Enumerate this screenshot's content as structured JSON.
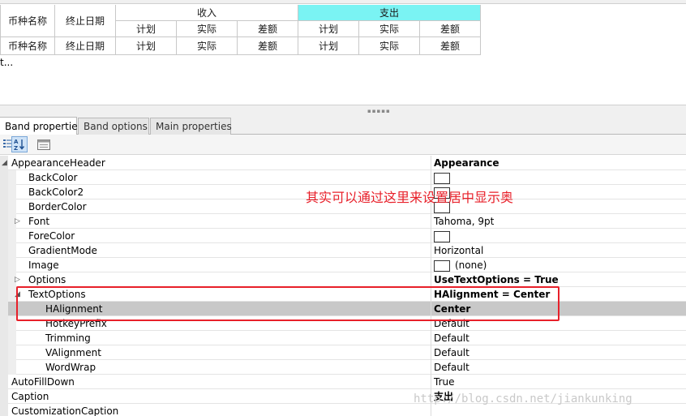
{
  "preview": {
    "header": {
      "currency_name": "币种名称",
      "end_date": "终止日期",
      "income_band": "收入",
      "expense_band": "支出",
      "income_cols": [
        "计划",
        "实际",
        "差额"
      ],
      "expense_cols": [
        "计划",
        "实际",
        "差额"
      ]
    },
    "data_row": {
      "currency_name": "币种名称",
      "end_date": "终止日期",
      "cells": [
        "计划",
        "实际",
        "差额",
        "计划",
        "实际",
        "差额"
      ]
    },
    "truncated_text": "t..."
  },
  "tabs": [
    {
      "label": "Band properties",
      "active": true
    },
    {
      "label": "Band options",
      "active": false
    },
    {
      "label": "Main properties",
      "active": false
    }
  ],
  "toolbar": {
    "categorized_icon": "categorized-icon",
    "alphabetical_icon": "sort-az-icon",
    "property_pages_icon": "property-pages-icon"
  },
  "properties": [
    {
      "name": "AppearanceHeader",
      "value": "Appearance",
      "bold": true,
      "level": 0,
      "expander": "collapse"
    },
    {
      "name": "BackColor",
      "value": "",
      "swatch": true,
      "level": 1
    },
    {
      "name": "BackColor2",
      "value": "",
      "swatch": true,
      "level": 1
    },
    {
      "name": "BorderColor",
      "value": "",
      "swatch": true,
      "level": 1
    },
    {
      "name": "Font",
      "value": "Tahoma, 9pt",
      "level": 1,
      "expander": "expand"
    },
    {
      "name": "ForeColor",
      "value": "",
      "swatch": true,
      "level": 1
    },
    {
      "name": "GradientMode",
      "value": "Horizontal",
      "level": 1
    },
    {
      "name": "Image",
      "value": "(none)",
      "swatch": true,
      "level": 1
    },
    {
      "name": "Options",
      "value": "UseTextOptions = True",
      "bold": true,
      "level": 1,
      "expander": "expand"
    },
    {
      "name": "TextOptions",
      "value": "HAlignment = Center",
      "bold": true,
      "level": 1,
      "expander": "collapse"
    },
    {
      "name": "HAlignment",
      "value": "Center",
      "bold": true,
      "level": 2,
      "selected": true
    },
    {
      "name": "HotkeyPrefix",
      "value": "Default",
      "level": 2
    },
    {
      "name": "Trimming",
      "value": "Default",
      "level": 2
    },
    {
      "name": "VAlignment",
      "value": "Default",
      "level": 2
    },
    {
      "name": "WordWrap",
      "value": "Default",
      "level": 2
    },
    {
      "name": "AutoFillDown",
      "value": "True",
      "level": 0
    },
    {
      "name": "Caption",
      "value": "支出",
      "bold": true,
      "level": 0
    },
    {
      "name": "CustomizationCaption",
      "value": "",
      "level": 0
    }
  ],
  "annotation": {
    "note": "其实可以通过这里来设置居中显示奥",
    "box_color": "#e8202a"
  },
  "watermark": "http://blog.csdn.net/jiankunking",
  "colors": {
    "active_band": "#7af3f3",
    "selected_row": "#c8c8c8",
    "annotation": "#e8202a"
  }
}
